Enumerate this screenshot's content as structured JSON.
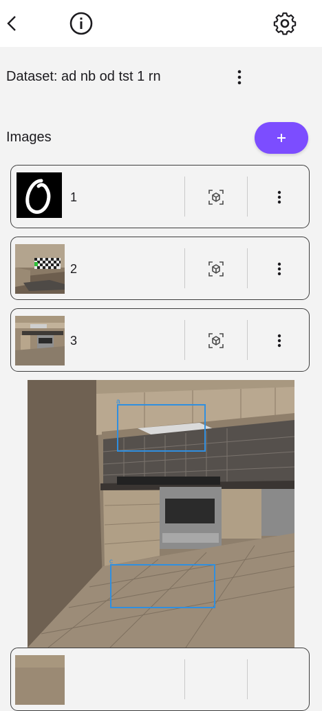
{
  "appbar": {
    "back_icon": "arrow-back-icon",
    "info_icon": "info-icon",
    "settings_icon": "gear-icon"
  },
  "dataset": {
    "title": "Dataset: ad nb od tst 1 rn",
    "menu_icon": "more-vert-icon"
  },
  "images_section": {
    "label": "Images",
    "add_icon": "plus-icon",
    "accent_color": "#7c4dff"
  },
  "images": [
    {
      "label": "1",
      "thumbnail": "handwritten-digit-zero"
    },
    {
      "label": "2",
      "thumbnail": "room-with-checkerboard"
    },
    {
      "label": "3",
      "thumbnail": "kitchen"
    },
    {
      "label": "",
      "thumbnail": "kitchen"
    }
  ],
  "preview": {
    "image": "kitchen-photo",
    "boxes": [
      {
        "label": "a",
        "color": "#2f8fe0"
      },
      {
        "label": "c",
        "color": "#2f8fe0"
      }
    ]
  }
}
